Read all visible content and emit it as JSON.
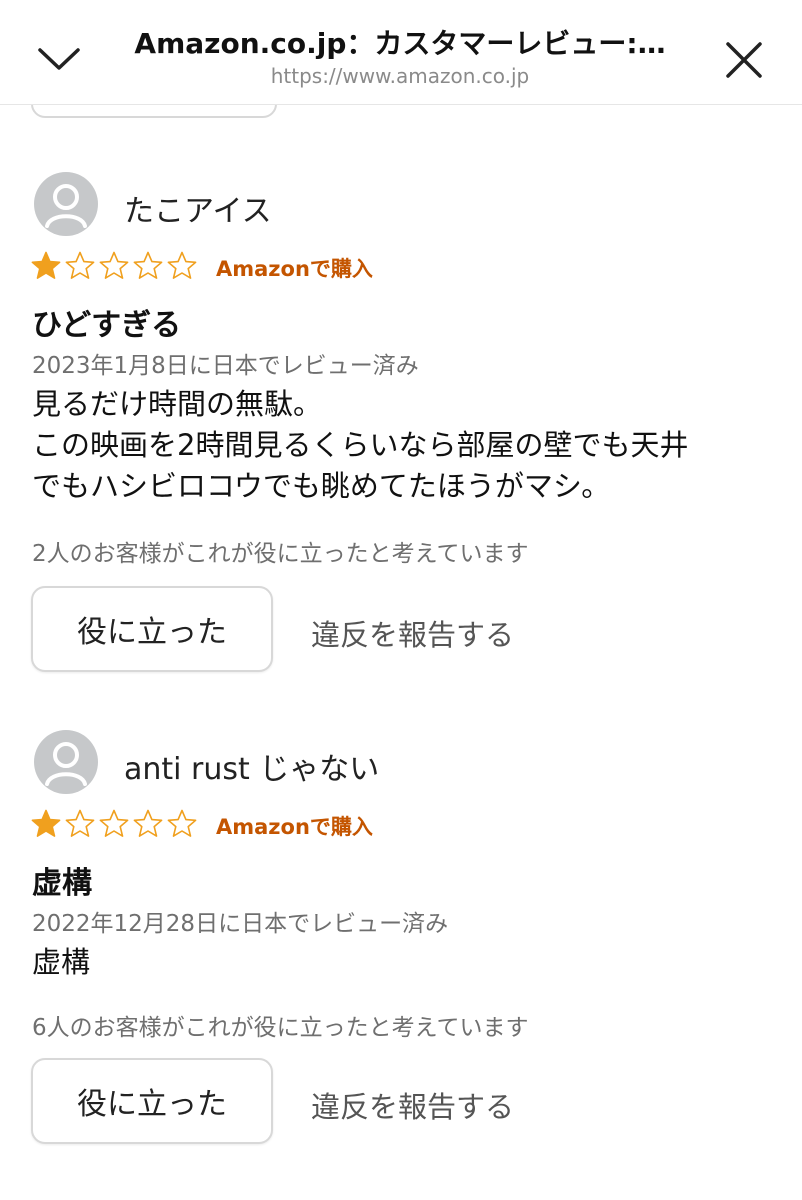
{
  "header": {
    "title": "Amazon.co.jp：カスタマーレビュー:…",
    "url": "https://www.amazon.co.jp"
  },
  "icons": {
    "collapse": "chevron-down-icon",
    "close": "close-icon",
    "avatar": "user-avatar-icon",
    "star_filled": "star-filled-icon",
    "star_empty": "star-empty-icon"
  },
  "colors": {
    "star": "#f0a01e",
    "verified": "#c45500",
    "muted_text": "#6f6f6f"
  },
  "reviews": [
    {
      "reviewer": "たこアイス",
      "rating": 1,
      "max_rating": 5,
      "verified_label": "Amazonで購入",
      "title": "ひどすぎる",
      "date": "2023年1月8日に日本でレビュー済み",
      "body_lines": [
        "見るだけ時間の無駄。",
        "この映画を2時間見るくらいなら部屋の壁でも天井",
        "でもハシビロコウでも眺めてたほうがマシ。"
      ],
      "helpful_count_text": "2人のお客様がこれが役に立ったと考えています",
      "helpful_button": "役に立った",
      "report_link": "違反を報告する"
    },
    {
      "reviewer": "anti rust じゃない",
      "rating": 1,
      "max_rating": 5,
      "verified_label": "Amazonで購入",
      "title": "虚構",
      "date": "2022年12月28日に日本でレビュー済み",
      "body_lines": [
        "虚構"
      ],
      "helpful_count_text": "6人のお客様がこれが役に立ったと考えています",
      "helpful_button": "役に立った",
      "report_link": "違反を報告する"
    }
  ]
}
